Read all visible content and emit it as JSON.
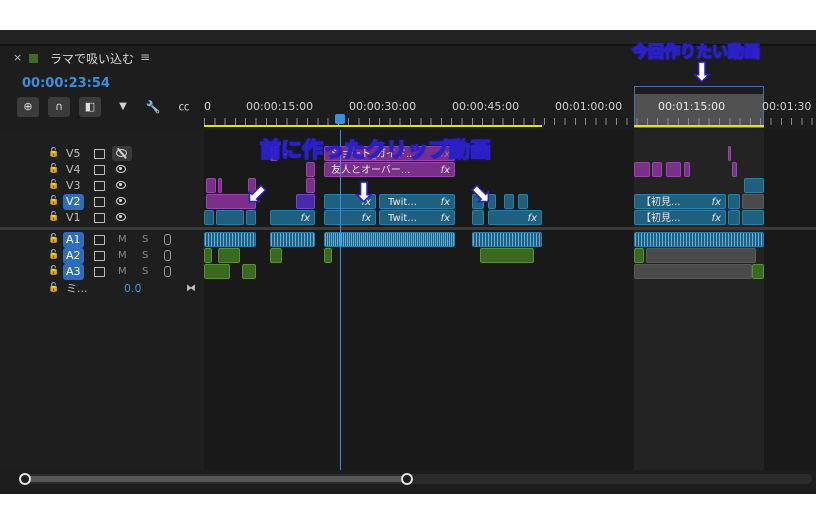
{
  "panel": {
    "close_glyph": "×",
    "sequence_name": "ラマで吸い込む",
    "menu_glyph": "≡",
    "timecode": "00:00:23:54"
  },
  "colors": {
    "accent_blue": "#3c8fe0",
    "playhead": "#3a8ee6",
    "work_area": "#e2e21a",
    "video_clip": "#1f5f7f",
    "purple_clip": "#7a2f8a",
    "audio_green": "#3a6a1f",
    "annotation_stroke": "#2a20c8"
  },
  "toolbar": [
    {
      "icon": "nest-icon",
      "glyph": "⊕"
    },
    {
      "icon": "snap-magnet-icon",
      "glyph": "∩"
    },
    {
      "icon": "linked-selection-icon",
      "glyph": "◧"
    },
    {
      "icon": "add-marker-icon",
      "glyph": "▼"
    },
    {
      "icon": "wrench-icon",
      "glyph": "🔧"
    },
    {
      "icon": "captions-icon",
      "glyph": "㏄"
    }
  ],
  "ruler": {
    "labels": [
      "0",
      "00:00:15:00",
      "00:00:30:00",
      "00:00:45:00",
      "00:01:00:00",
      "00:01:15:00",
      "00:01:30"
    ]
  },
  "tracks": {
    "video": [
      {
        "name": "V5",
        "selected": false,
        "visibility_icon": "eye-hidden-icon"
      },
      {
        "name": "V4",
        "selected": false,
        "visibility_icon": "eye-icon"
      },
      {
        "name": "V3",
        "selected": false,
        "visibility_icon": "eye-icon"
      },
      {
        "name": "V2",
        "selected": true,
        "visibility_icon": "eye-icon"
      },
      {
        "name": "V1",
        "selected": false,
        "visibility_icon": "eye-icon"
      }
    ],
    "audio": [
      {
        "name": "A1",
        "m": "M",
        "s": "S"
      },
      {
        "name": "A2",
        "m": "M",
        "s": "S"
      },
      {
        "name": "A3",
        "m": "M",
        "s": "S"
      }
    ],
    "mix": {
      "name": "ミ...",
      "value": "0.0"
    }
  },
  "clips": {
    "v5_title": "ショート_ガイド...",
    "v4_title": "友人とオーバー...",
    "v2_twit": "Twit...",
    "v1_twit": "Twit...",
    "v2_right": "【初見...",
    "v1_right": "【初見...",
    "fx": "fx"
  },
  "annotations": {
    "top_label": "今回作りたい動画",
    "middle_label": "前に作ったクリップ動画"
  }
}
